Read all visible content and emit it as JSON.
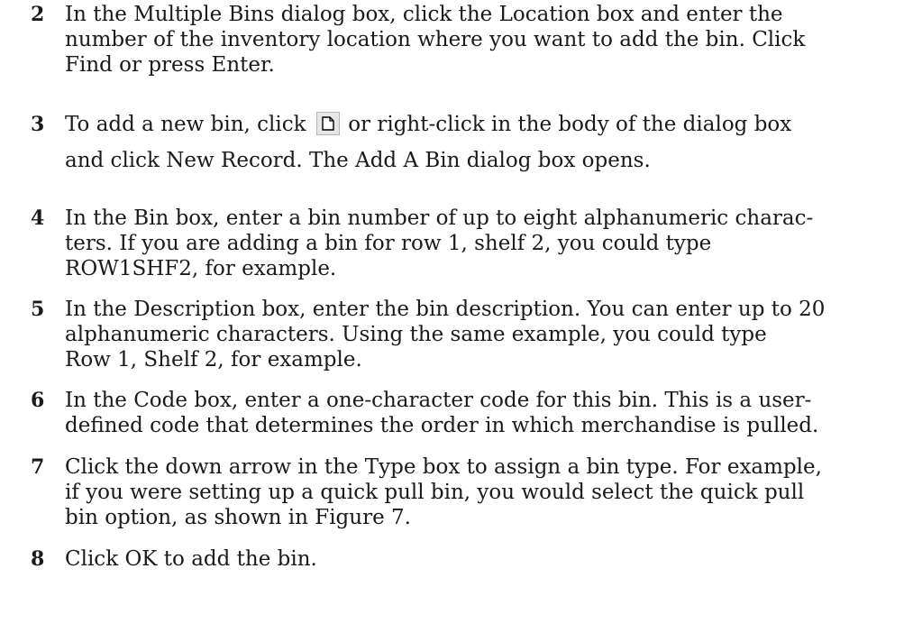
{
  "steps": [
    {
      "number": "2",
      "lines": [
        "In the Multiple Bins dialog box, click the Location box and enter the",
        "number of the inventory location where you want to add the bin. Click",
        "Find or press Enter."
      ]
    },
    {
      "number": "3",
      "line1_before": "To add a new bin, click",
      "icon": "new-record-icon",
      "line1_after": "or right-click in the body of the dialog box",
      "line2": "and click New Record. The Add A Bin dialog box opens."
    },
    {
      "number": "4",
      "lines": [
        "In the Bin box, enter a bin number of up to eight alphanumeric charac-",
        "ters. If you are adding a bin for row 1, shelf 2, you could type",
        "ROW1SHF2, for example."
      ]
    },
    {
      "number": "5",
      "lines": [
        "In the Description box, enter the bin description. You can enter up to 20",
        "alphanumeric characters. Using the same example, you could type",
        "Row 1, Shelf 2, for example."
      ]
    },
    {
      "number": "6",
      "lines": [
        "In the Code box, enter a one-character code for this bin. This is a user-",
        "defined code that determines the order in which merchandise is pulled."
      ]
    },
    {
      "number": "7",
      "lines": [
        "Click the down arrow in the Type box to assign a bin type. For example,",
        "if you were setting up a quick pull bin, you would select the quick pull",
        "bin option, as shown in Figure 7."
      ]
    },
    {
      "number": "8",
      "lines": [
        "Click OK to add the bin."
      ]
    }
  ]
}
